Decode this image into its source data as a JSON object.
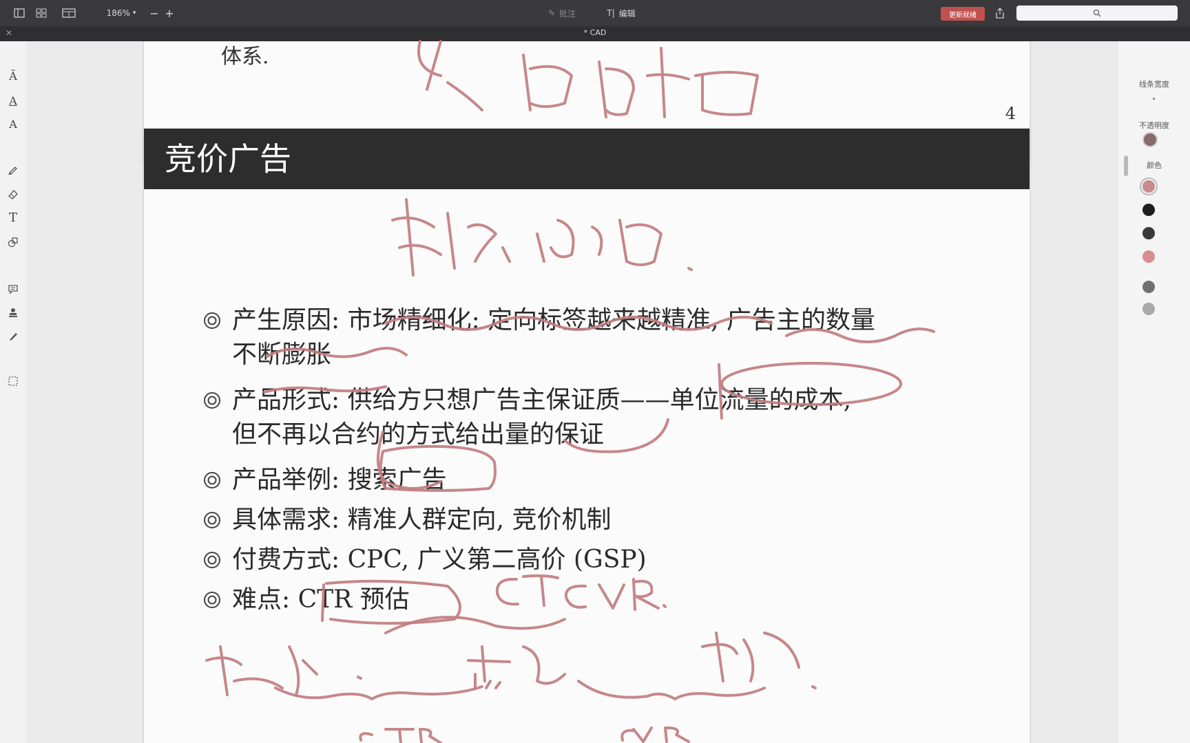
{
  "toolbar": {
    "zoom": "186%",
    "annotate_label": "批注",
    "edit_label": "编辑",
    "update_label": "更新就绪"
  },
  "tab": {
    "title": "* CAD"
  },
  "prev_page": {
    "text": "体系.",
    "page_number": "4"
  },
  "slide": {
    "title": "竞价广告",
    "bullets": [
      {
        "line1": "产生原因: 市场精细化: 定向标签越来越精准, 广告主的数量",
        "line2": "不断膨胀"
      },
      {
        "line1": "产品形式: 供给方只想广告主保证质——单位流量的成本,",
        "line2": "但不再以合约的方式给出量的保证"
      },
      {
        "line1": "产品举例: 搜索广告",
        "line2": ""
      },
      {
        "line1": "具体需求: 精准人群定向, 竞价机制",
        "line2": ""
      },
      {
        "line1": "付费方式: CPC, 广义第二高价 (GSP)",
        "line2": ""
      },
      {
        "line1": "难点: CTR 预估",
        "line2": ""
      }
    ]
  },
  "right_panel": {
    "line_width_label": "线条宽度",
    "opacity_label": "不透明度",
    "color_label": "颜色",
    "swatches": [
      "#c98a8e",
      "#1e1e1e",
      "#3a3a3a",
      "#d88d93",
      "#707070",
      "#a9a9a9"
    ]
  },
  "icons": {
    "sidebar_toggle": "sidebar-icon",
    "grid_view": "grid-icon",
    "page_view": "page-layout-icon",
    "zoom_out": "minus-icon",
    "zoom_in": "plus-icon",
    "share": "share-icon",
    "search": "search-icon"
  }
}
